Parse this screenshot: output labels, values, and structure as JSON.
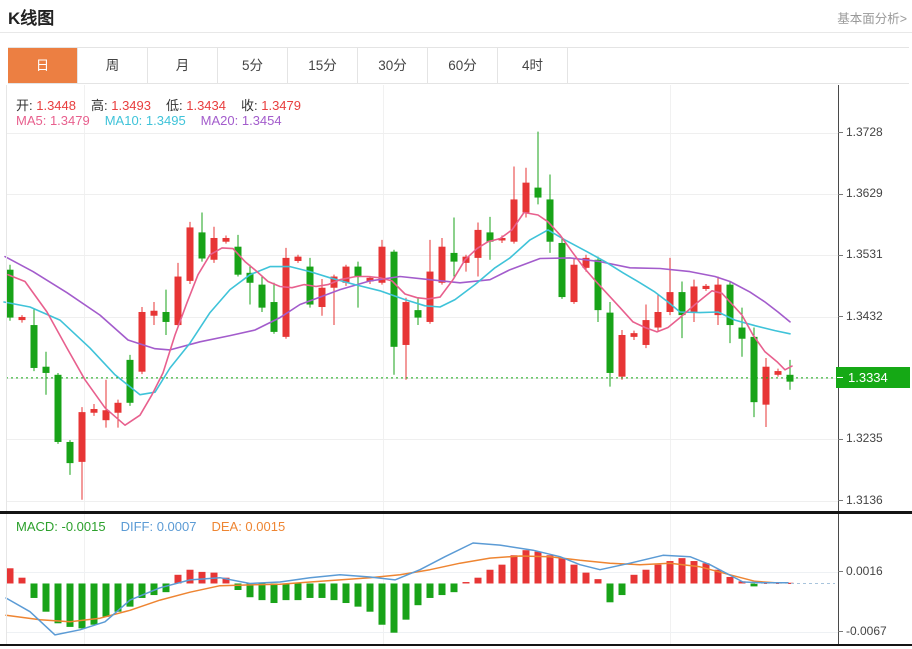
{
  "header": {
    "title": "K线图",
    "link": "基本面分析>"
  },
  "tabs": [
    {
      "label": "日",
      "active": true
    },
    {
      "label": "周",
      "active": false
    },
    {
      "label": "月",
      "active": false
    },
    {
      "label": "5分",
      "active": false
    },
    {
      "label": "15分",
      "active": false
    },
    {
      "label": "30分",
      "active": false
    },
    {
      "label": "60分",
      "active": false
    },
    {
      "label": "4时",
      "active": false
    }
  ],
  "info": {
    "ohlc": [
      {
        "label": "开:",
        "value": "1.3448"
      },
      {
        "label": "高:",
        "value": "1.3493"
      },
      {
        "label": "低:",
        "value": "1.3434"
      },
      {
        "label": "收:",
        "value": "1.3479"
      }
    ],
    "ma": [
      {
        "label": "MA5:",
        "value": "1.3479",
        "color": "#e8608e"
      },
      {
        "label": "MA10:",
        "value": "1.3495",
        "color": "#3fc3d9"
      },
      {
        "label": "MA20:",
        "value": "1.3454",
        "color": "#a35ccc"
      }
    ]
  },
  "macd_info": [
    {
      "label": "MACD:",
      "value": "-0.0015",
      "color": "#2ca02c"
    },
    {
      "label": "DIFF:",
      "value": "0.0007",
      "color": "#5b9bd5"
    },
    {
      "label": "DEA:",
      "value": "0.0015",
      "color": "#ee8532"
    }
  ],
  "colors": {
    "candle_up": "#e73535",
    "candle_down": "#18a318",
    "ma5": "#e8608e",
    "ma10": "#3fc3d9",
    "ma20": "#a35ccc",
    "diff": "#5b9bd5",
    "dea": "#ee8532",
    "tab_accent": "#ec7f42",
    "price_green": "#15a915",
    "macd_tail_dash": "#a8c4dc",
    "ohlc_value": "#e83e3e"
  },
  "chart_data": {
    "type": "candlestick",
    "title": "K线图",
    "panels": [
      "price with MA5/MA10/MA20",
      "MACD histogram with DIFF/DEA"
    ],
    "main": {
      "ylim": [
        1.312,
        1.3805
      ],
      "y_ticks": [
        "1.3728",
        "1.3629",
        "1.3531",
        "1.3432",
        "1.3334",
        "1.3235",
        "1.3136"
      ],
      "current_price": "1.3334",
      "candles_ohlc": [
        [
          1.3508,
          1.3516,
          1.3426,
          1.3431
        ],
        [
          1.3427,
          1.3435,
          1.3423,
          1.3432
        ],
        [
          1.3419,
          1.3444,
          1.3345,
          1.335
        ],
        [
          1.3352,
          1.3376,
          1.3307,
          1.3342
        ],
        [
          1.3339,
          1.3342,
          1.3228,
          1.3231
        ],
        [
          1.3231,
          1.3234,
          1.3178,
          1.3197
        ],
        [
          1.3199,
          1.3287,
          1.3138,
          1.3279
        ],
        [
          1.3278,
          1.3292,
          1.3273,
          1.3284
        ],
        [
          1.3266,
          1.3331,
          1.3254,
          1.3282
        ],
        [
          1.3278,
          1.3299,
          1.3254,
          1.3294
        ],
        [
          1.3363,
          1.3371,
          1.3289,
          1.3294
        ],
        [
          1.3344,
          1.3448,
          1.334,
          1.344
        ],
        [
          1.3434,
          1.3456,
          1.3419,
          1.3442
        ],
        [
          1.344,
          1.3476,
          1.3403,
          1.3424
        ],
        [
          1.3419,
          1.3519,
          1.3414,
          1.3497
        ],
        [
          1.349,
          1.3585,
          1.3485,
          1.3576
        ],
        [
          1.3568,
          1.36,
          1.3521,
          1.3526
        ],
        [
          1.3524,
          1.3577,
          1.3519,
          1.3559
        ],
        [
          1.3553,
          1.3563,
          1.355,
          1.3559
        ],
        [
          1.3545,
          1.3564,
          1.3497,
          1.35
        ],
        [
          1.3503,
          1.3516,
          1.3452,
          1.3487
        ],
        [
          1.3484,
          1.3497,
          1.344,
          1.3447
        ],
        [
          1.3456,
          1.3487,
          1.3405,
          1.3408
        ],
        [
          1.34,
          1.3543,
          1.3397,
          1.3527
        ],
        [
          1.3522,
          1.3532,
          1.3519,
          1.3529
        ],
        [
          1.3513,
          1.3527,
          1.3447,
          1.3452
        ],
        [
          1.3448,
          1.3493,
          1.3434,
          1.3479
        ],
        [
          1.3479,
          1.35,
          1.3419,
          1.3497
        ],
        [
          1.3487,
          1.3516,
          1.3482,
          1.3513
        ],
        [
          1.3513,
          1.3521,
          1.3447,
          1.3497
        ],
        [
          1.3489,
          1.3498,
          1.3485,
          1.3495
        ],
        [
          1.3487,
          1.3556,
          1.3484,
          1.3545
        ],
        [
          1.3537,
          1.354,
          1.3339,
          1.3384
        ],
        [
          1.3387,
          1.3463,
          1.3331,
          1.3456
        ],
        [
          1.3443,
          1.3463,
          1.3419,
          1.3431
        ],
        [
          1.3424,
          1.3556,
          1.3421,
          1.3505
        ],
        [
          1.3487,
          1.3559,
          1.3484,
          1.3545
        ],
        [
          1.3535,
          1.3592,
          1.3497,
          1.3521
        ],
        [
          1.3519,
          1.3532,
          1.3505,
          1.3529
        ],
        [
          1.3527,
          1.3584,
          1.3497,
          1.3572
        ],
        [
          1.3568,
          1.3593,
          1.3524,
          1.3553
        ],
        [
          1.3555,
          1.3563,
          1.3551,
          1.3559
        ],
        [
          1.3553,
          1.3674,
          1.355,
          1.3621
        ],
        [
          1.36,
          1.3672,
          1.3592,
          1.3648
        ],
        [
          1.364,
          1.373,
          1.3613,
          1.3624
        ],
        [
          1.3621,
          1.3661,
          1.3535,
          1.3553
        ],
        [
          1.3551,
          1.3559,
          1.3461,
          1.3464
        ],
        [
          1.3456,
          1.3527,
          1.3453,
          1.3516
        ],
        [
          1.3511,
          1.3532,
          1.3505,
          1.3527
        ],
        [
          1.3524,
          1.3529,
          1.3424,
          1.3443
        ],
        [
          1.3439,
          1.3456,
          1.332,
          1.3342
        ],
        [
          1.3336,
          1.3411,
          1.3331,
          1.3403
        ],
        [
          1.34,
          1.341,
          1.3395,
          1.3406
        ],
        [
          1.3387,
          1.3452,
          1.3382,
          1.3427
        ],
        [
          1.3415,
          1.3468,
          1.3408,
          1.344
        ],
        [
          1.344,
          1.3527,
          1.3435,
          1.3472
        ],
        [
          1.3472,
          1.3489,
          1.3398,
          1.3435
        ],
        [
          1.3439,
          1.3492,
          1.3424,
          1.3481
        ],
        [
          1.3477,
          1.3485,
          1.3474,
          1.3482
        ],
        [
          1.3435,
          1.3497,
          1.3419,
          1.3484
        ],
        [
          1.3484,
          1.3489,
          1.339,
          1.3419
        ],
        [
          1.3415,
          1.3447,
          1.3368,
          1.3397
        ],
        [
          1.34,
          1.3415,
          1.3271,
          1.3295
        ],
        [
          1.3291,
          1.3366,
          1.3255,
          1.3352
        ],
        [
          1.3339,
          1.3349,
          1.3336,
          1.3345
        ],
        [
          1.3339,
          1.3363,
          1.3315,
          1.3328
        ]
      ],
      "ma5": [
        [
          8,
          1.35
        ],
        [
          25,
          1.3489
        ],
        [
          47,
          1.344
        ],
        [
          67,
          1.3382
        ],
        [
          85,
          1.3331
        ],
        [
          105,
          1.3286
        ],
        [
          125,
          1.3258
        ],
        [
          140,
          1.3274
        ],
        [
          152,
          1.3307
        ],
        [
          163,
          1.3342
        ],
        [
          175,
          1.3403
        ],
        [
          187,
          1.3455
        ],
        [
          198,
          1.35
        ],
        [
          210,
          1.3532
        ],
        [
          222,
          1.3543
        ],
        [
          233,
          1.3542
        ],
        [
          245,
          1.3521
        ],
        [
          257,
          1.3505
        ],
        [
          268,
          1.3489
        ],
        [
          280,
          1.3481
        ],
        [
          292,
          1.3479
        ],
        [
          304,
          1.3484
        ],
        [
          316,
          1.3481
        ],
        [
          328,
          1.3484
        ],
        [
          340,
          1.3492
        ],
        [
          356,
          1.3497
        ],
        [
          368,
          1.3497
        ],
        [
          380,
          1.3495
        ],
        [
          392,
          1.349
        ],
        [
          405,
          1.3469
        ],
        [
          417,
          1.3463
        ],
        [
          428,
          1.3461
        ],
        [
          440,
          1.3464
        ],
        [
          453,
          1.3492
        ],
        [
          465,
          1.3524
        ],
        [
          477,
          1.3542
        ],
        [
          488,
          1.3553
        ],
        [
          500,
          1.3558
        ],
        [
          512,
          1.3572
        ],
        [
          524,
          1.36
        ],
        [
          538,
          1.3596
        ],
        [
          548,
          1.3585
        ],
        [
          560,
          1.3564
        ],
        [
          572,
          1.3537
        ],
        [
          584,
          1.3511
        ],
        [
          596,
          1.3489
        ],
        [
          608,
          1.3468
        ],
        [
          620,
          1.3447
        ],
        [
          633,
          1.3424
        ],
        [
          645,
          1.3415
        ],
        [
          657,
          1.3408
        ],
        [
          668,
          1.3415
        ],
        [
          680,
          1.3431
        ],
        [
          695,
          1.3452
        ],
        [
          712,
          1.3474
        ],
        [
          722,
          1.347
        ],
        [
          730,
          1.3456
        ],
        [
          742,
          1.3435
        ],
        [
          753,
          1.3403
        ],
        [
          765,
          1.3376
        ],
        [
          777,
          1.336
        ],
        [
          785,
          1.3347
        ],
        [
          792,
          1.3353
        ]
      ],
      "ma10": [
        [
          4,
          1.3456
        ],
        [
          30,
          1.3448
        ],
        [
          60,
          1.3427
        ],
        [
          90,
          1.3382
        ],
        [
          115,
          1.3339
        ],
        [
          140,
          1.3307
        ],
        [
          155,
          1.3311
        ],
        [
          170,
          1.335
        ],
        [
          190,
          1.339
        ],
        [
          210,
          1.3439
        ],
        [
          230,
          1.3476
        ],
        [
          250,
          1.35
        ],
        [
          270,
          1.3513
        ],
        [
          290,
          1.3513
        ],
        [
          310,
          1.3505
        ],
        [
          330,
          1.3495
        ],
        [
          355,
          1.3484
        ],
        [
          380,
          1.3474
        ],
        [
          405,
          1.346
        ],
        [
          425,
          1.345
        ],
        [
          440,
          1.3448
        ],
        [
          455,
          1.346
        ],
        [
          475,
          1.3484
        ],
        [
          495,
          1.3511
        ],
        [
          510,
          1.3527
        ],
        [
          530,
          1.3556
        ],
        [
          548,
          1.3572
        ],
        [
          565,
          1.3556
        ],
        [
          587,
          1.3537
        ],
        [
          605,
          1.3521
        ],
        [
          623,
          1.3503
        ],
        [
          640,
          1.3487
        ],
        [
          655,
          1.3472
        ],
        [
          668,
          1.3456
        ],
        [
          680,
          1.344
        ],
        [
          700,
          1.3439
        ],
        [
          718,
          1.344
        ],
        [
          735,
          1.3427
        ],
        [
          755,
          1.3418
        ],
        [
          775,
          1.341
        ],
        [
          790,
          1.3405
        ]
      ],
      "ma20": [
        [
          5,
          1.3529
        ],
        [
          33,
          1.3505
        ],
        [
          67,
          1.3471
        ],
        [
          100,
          1.3435
        ],
        [
          128,
          1.3395
        ],
        [
          155,
          1.3381
        ],
        [
          170,
          1.3379
        ],
        [
          200,
          1.3392
        ],
        [
          230,
          1.3402
        ],
        [
          255,
          1.3411
        ],
        [
          280,
          1.3431
        ],
        [
          300,
          1.3452
        ],
        [
          320,
          1.3464
        ],
        [
          340,
          1.3476
        ],
        [
          370,
          1.349
        ],
        [
          400,
          1.3497
        ],
        [
          430,
          1.3492
        ],
        [
          460,
          1.3487
        ],
        [
          490,
          1.3492
        ],
        [
          510,
          1.3508
        ],
        [
          540,
          1.3526
        ],
        [
          570,
          1.3527
        ],
        [
          600,
          1.3521
        ],
        [
          630,
          1.3511
        ],
        [
          660,
          1.351
        ],
        [
          690,
          1.3505
        ],
        [
          715,
          1.3497
        ],
        [
          730,
          1.3489
        ],
        [
          750,
          1.3472
        ],
        [
          765,
          1.3456
        ],
        [
          778,
          1.344
        ],
        [
          790,
          1.3424
        ]
      ]
    },
    "macd": {
      "ylim": [
        -0.0085,
        0.0096
      ],
      "y_ticks": [
        "0.0016",
        "-0.0067"
      ],
      "histogram": [
        0.0021,
        0.0008,
        -0.002,
        -0.0039,
        -0.0055,
        -0.006,
        -0.0062,
        -0.0057,
        -0.0046,
        -0.0039,
        -0.0032,
        -0.002,
        -0.0016,
        -0.0012,
        0.0012,
        0.0019,
        0.0016,
        0.0015,
        0.0008,
        -0.0009,
        -0.0019,
        -0.0023,
        -0.0027,
        -0.0023,
        -0.0023,
        -0.002,
        -0.002,
        -0.0023,
        -0.0027,
        -0.0032,
        -0.0039,
        -0.0057,
        -0.0068,
        -0.005,
        -0.003,
        -0.002,
        -0.0016,
        -0.0012,
        0.0002,
        0.0008,
        0.0019,
        0.0026,
        0.0039,
        0.0046,
        0.0044,
        0.0039,
        0.0035,
        0.0026,
        0.0015,
        0.0006,
        -0.0026,
        -0.0016,
        0.0012,
        0.0019,
        0.0026,
        0.0031,
        0.0035,
        0.0031,
        0.0028,
        0.0019,
        0.0009,
        0.0003,
        -0.0004,
        0.0001,
        0.0001,
        0.0001
      ],
      "diff": [
        [
          6,
          -0.002
        ],
        [
          30,
          -0.0039
        ],
        [
          55,
          -0.0071
        ],
        [
          80,
          -0.0064
        ],
        [
          105,
          -0.0053
        ],
        [
          130,
          -0.0023
        ],
        [
          160,
          -0.0006
        ],
        [
          190,
          0.0005
        ],
        [
          220,
          0.0008
        ],
        [
          250,
          0.0
        ],
        [
          280,
          0.0002
        ],
        [
          310,
          0.0008
        ],
        [
          340,
          0.0012
        ],
        [
          370,
          0.0009
        ],
        [
          395,
          0.0005
        ],
        [
          420,
          0.0019
        ],
        [
          445,
          0.0037
        ],
        [
          473,
          0.0056
        ],
        [
          500,
          0.0053
        ],
        [
          533,
          0.0046
        ],
        [
          560,
          0.0037
        ],
        [
          580,
          0.0026
        ],
        [
          600,
          0.0019
        ],
        [
          630,
          0.0028
        ],
        [
          663,
          0.0039
        ],
        [
          690,
          0.0037
        ],
        [
          710,
          0.0026
        ],
        [
          743,
          0.0002
        ],
        [
          765,
          0.0001
        ],
        [
          788,
          0.0001
        ]
      ],
      "dea": [
        [
          6,
          -0.0044
        ],
        [
          40,
          -0.005
        ],
        [
          70,
          -0.0053
        ],
        [
          100,
          -0.0048
        ],
        [
          130,
          -0.0037
        ],
        [
          160,
          -0.0023
        ],
        [
          190,
          -0.0012
        ],
        [
          220,
          -0.0003
        ],
        [
          250,
          -0.0002
        ],
        [
          280,
          -0.0001
        ],
        [
          310,
          0.0002
        ],
        [
          340,
          0.0005
        ],
        [
          370,
          0.0008
        ],
        [
          400,
          0.0012
        ],
        [
          430,
          0.0019
        ],
        [
          460,
          0.0028
        ],
        [
          490,
          0.0035
        ],
        [
          520,
          0.0038
        ],
        [
          550,
          0.0037
        ],
        [
          580,
          0.0032
        ],
        [
          610,
          0.0028
        ],
        [
          640,
          0.0026
        ],
        [
          670,
          0.0028
        ],
        [
          700,
          0.0023
        ],
        [
          730,
          0.0012
        ],
        [
          755,
          0.0003
        ],
        [
          775,
          0.0001
        ],
        [
          788,
          0.0001
        ]
      ]
    }
  }
}
